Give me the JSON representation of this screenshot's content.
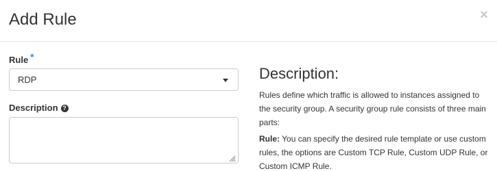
{
  "modal": {
    "title": "Add Rule",
    "close_glyph": "×"
  },
  "form": {
    "rule_label": "Rule",
    "required_marker": "*",
    "rule_value": "RDP",
    "description_label": "Description",
    "description_value": ""
  },
  "help": {
    "title": "Description:",
    "intro": "Rules define which traffic is allowed to instances assigned to the security group. A security group rule consists of three main parts:",
    "rule_term": "Rule:",
    "rule_text": " You can specify the desired rule template or use custom rules, the options are Custom TCP Rule, Custom UDP Rule, or Custom ICMP Rule."
  },
  "icons": {
    "close": "close-icon",
    "caret": "chevron-down-icon",
    "help": "question-circle-icon",
    "resize": "resize-grip-icon"
  },
  "colors": {
    "required": "#428bca",
    "close": "#c8c8c8",
    "border": "#cccccc",
    "text": "#333333"
  }
}
